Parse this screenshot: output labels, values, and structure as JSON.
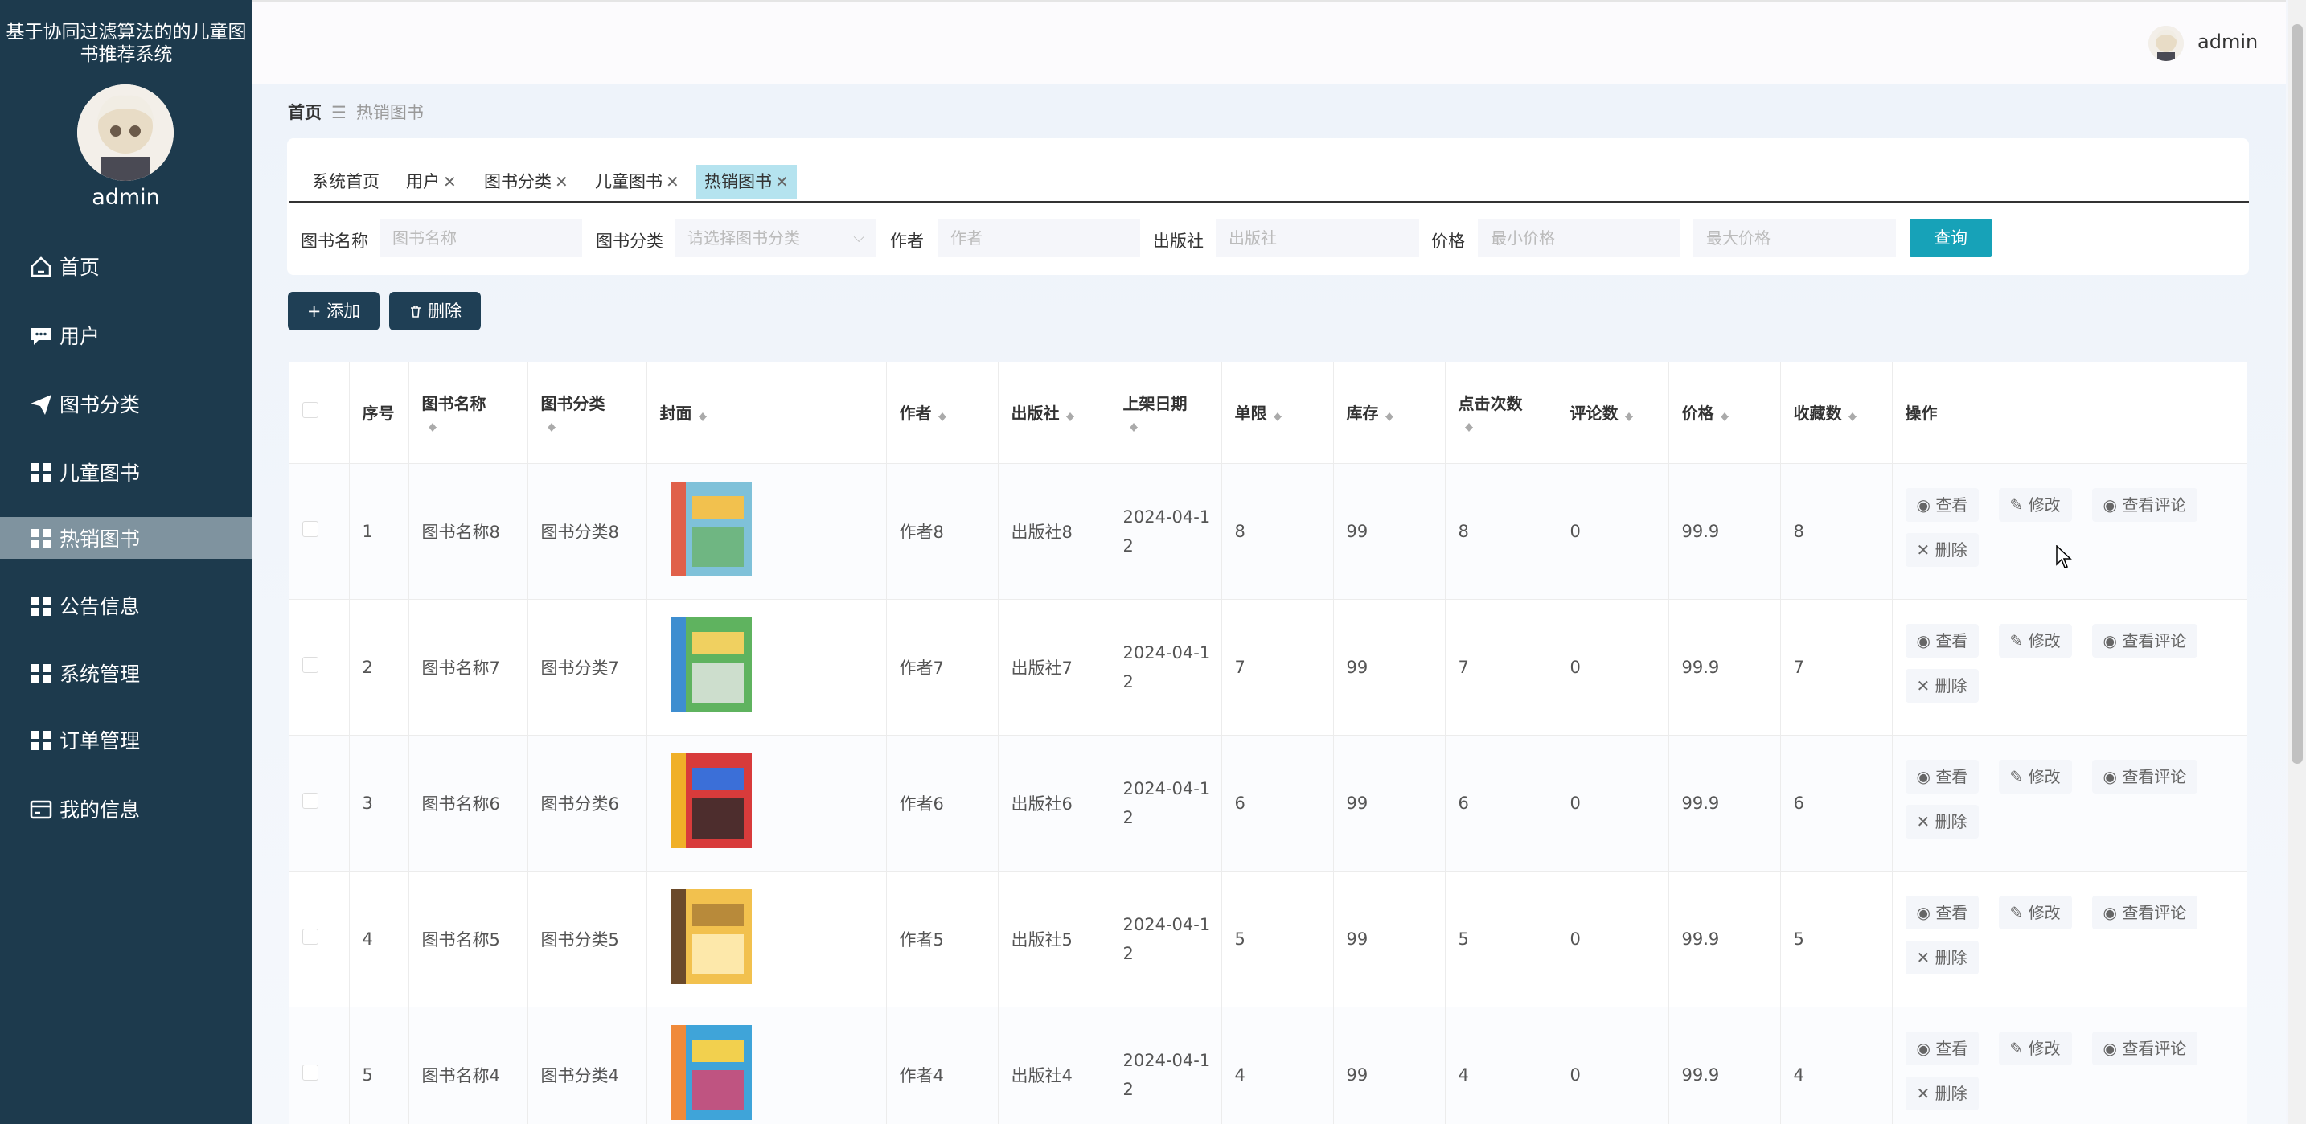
{
  "sidebar": {
    "title": "基于协同过滤算法的的儿童图书推荐系统",
    "username": "admin",
    "items": [
      {
        "label": "首页",
        "icon": "home-icon"
      },
      {
        "label": "用户",
        "icon": "chat-icon"
      },
      {
        "label": "图书分类",
        "icon": "paper-plane-icon"
      },
      {
        "label": "儿童图书",
        "icon": "grid-icon"
      },
      {
        "label": "热销图书",
        "icon": "grid-icon",
        "active": true
      },
      {
        "label": "公告信息",
        "icon": "grid-icon"
      },
      {
        "label": "系统管理",
        "icon": "grid-icon"
      },
      {
        "label": "订单管理",
        "icon": "grid-icon"
      },
      {
        "label": "我的信息",
        "icon": "id-card-icon"
      }
    ]
  },
  "topbar": {
    "username": "admin"
  },
  "breadcrumb": {
    "home": "首页",
    "sep": "☰",
    "current": "热销图书"
  },
  "tabs": [
    {
      "label": "系统首页",
      "closable": false
    },
    {
      "label": "用户",
      "closable": true
    },
    {
      "label": "图书分类",
      "closable": true
    },
    {
      "label": "儿童图书",
      "closable": true
    },
    {
      "label": "热销图书",
      "closable": true,
      "active": true
    }
  ],
  "search": {
    "name_label": "图书名称",
    "name_placeholder": "图书名称",
    "category_label": "图书分类",
    "category_placeholder": "请选择图书分类",
    "author_label": "作者",
    "author_placeholder": "作者",
    "publisher_label": "出版社",
    "publisher_placeholder": "出版社",
    "price_label": "价格",
    "min_price_placeholder": "最小价格",
    "max_price_placeholder": "最大价格",
    "query_button": "查询"
  },
  "actions": {
    "add_button": "+ 添加",
    "delete_button": "删除"
  },
  "table": {
    "headers": [
      "序号",
      "图书名称",
      "图书分类",
      "封面",
      "作者",
      "出版社",
      "上架日期",
      "单限",
      "库存",
      "点击次数",
      "评论数",
      "价格",
      "收藏数",
      "操作"
    ],
    "row_actions": {
      "view": "查看",
      "edit": "修改",
      "view_comments": "查看评论",
      "delete": "删除"
    },
    "rows": [
      {
        "no": "1",
        "name": "图书名称8",
        "category": "图书分类8",
        "author": "作者8",
        "publisher": "出版社8",
        "date": "2024-04-12",
        "limit": "8",
        "stock": "99",
        "clicks": "8",
        "comments": "0",
        "price": "99.9",
        "favorites": "8"
      },
      {
        "no": "2",
        "name": "图书名称7",
        "category": "图书分类7",
        "author": "作者7",
        "publisher": "出版社7",
        "date": "2024-04-12",
        "limit": "7",
        "stock": "99",
        "clicks": "7",
        "comments": "0",
        "price": "99.9",
        "favorites": "7"
      },
      {
        "no": "3",
        "name": "图书名称6",
        "category": "图书分类6",
        "author": "作者6",
        "publisher": "出版社6",
        "date": "2024-04-12",
        "limit": "6",
        "stock": "99",
        "clicks": "6",
        "comments": "0",
        "price": "99.9",
        "favorites": "6"
      },
      {
        "no": "4",
        "name": "图书名称5",
        "category": "图书分类5",
        "author": "作者5",
        "publisher": "出版社5",
        "date": "2024-04-12",
        "limit": "5",
        "stock": "99",
        "clicks": "5",
        "comments": "0",
        "price": "99.9",
        "favorites": "5"
      },
      {
        "no": "5",
        "name": "图书名称4",
        "category": "图书分类4",
        "author": "作者4",
        "publisher": "出版社4",
        "date": "2024-04-12",
        "limit": "4",
        "stock": "99",
        "clicks": "4",
        "comments": "0",
        "price": "99.9",
        "favorites": "4"
      }
    ]
  },
  "colors": {
    "sidebar_bg": "#1d3a4d",
    "accent": "#17a2b8",
    "active_tab": "#b5e3ef"
  }
}
